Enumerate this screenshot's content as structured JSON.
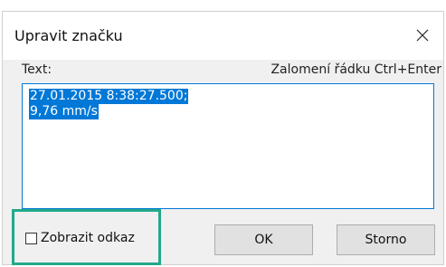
{
  "dialog": {
    "title": "Upravit značku",
    "close_icon": "close-icon"
  },
  "text_section": {
    "label": "Text:",
    "hint": "Zalomení řádku Ctrl+Enter",
    "lines": [
      "27.01.2015 8:38:27.500;",
      "9,76 mm/s"
    ]
  },
  "options": {
    "show_link_label": "Zobrazit odkaz",
    "show_link_checked": false
  },
  "buttons": {
    "ok_label": "OK",
    "cancel_label": "Storno"
  },
  "colors": {
    "selection": "#0078d7",
    "highlight_frame": "#22a98a"
  }
}
